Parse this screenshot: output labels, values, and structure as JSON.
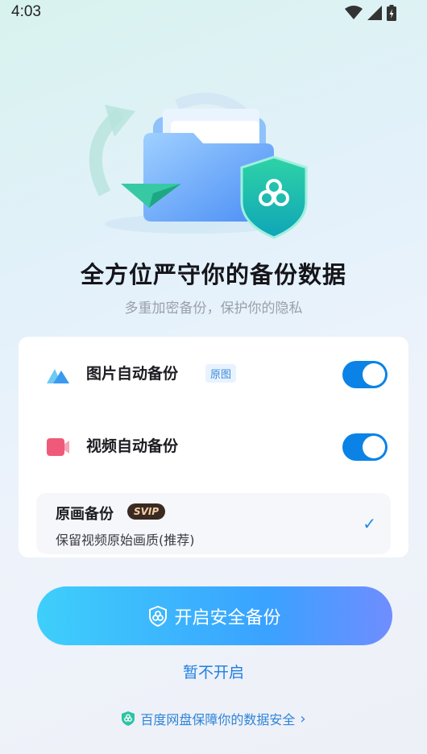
{
  "status_bar": {
    "time": "4:03"
  },
  "hero": {
    "title": "全方位严守你的备份数据",
    "subtitle": "多重加密备份，保护你的隐私"
  },
  "settings": {
    "photo_backup": {
      "label": "图片自动备份",
      "badge": "原图",
      "enabled": true
    },
    "video_backup": {
      "label": "视频自动备份",
      "enabled": true
    },
    "original_quality": {
      "title": "原画备份",
      "badge": "SVIP",
      "description": "保留视频原始画质(推荐)",
      "selected": true
    }
  },
  "actions": {
    "primary": "开启安全备份",
    "secondary": "暂不开启"
  },
  "footer": {
    "text": "百度网盘保障你的数据安全"
  },
  "colors": {
    "accent": "#0b83e6",
    "link": "#1e7fe0",
    "svip_bg": "#3a2a22"
  }
}
